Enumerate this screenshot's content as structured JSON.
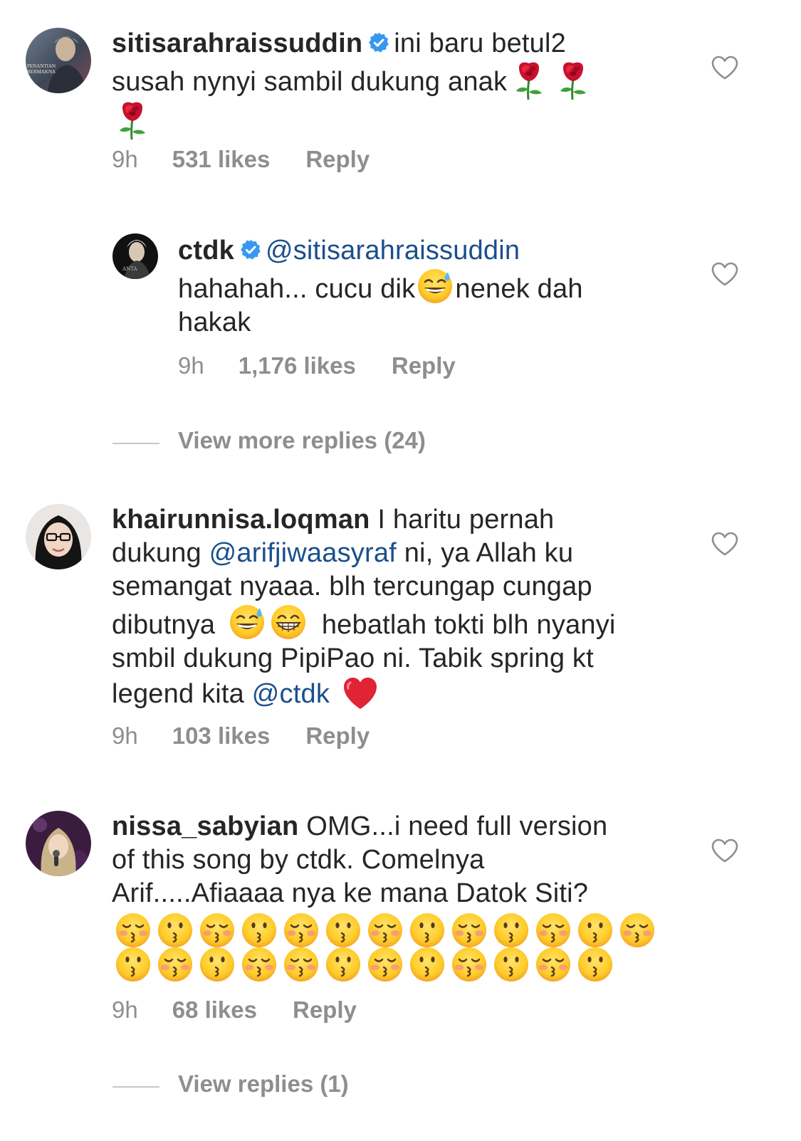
{
  "comments": [
    {
      "username": "sitisarahraissuddin",
      "verified": true,
      "text_1": "ini baru betul2",
      "text_2": "susah nynyi sambil dukung anak",
      "time": "9h",
      "likes": "531 likes",
      "reply": "Reply",
      "avatar_caption": "PENANTIAN BERMAKNA"
    },
    {
      "username": "ctdk",
      "verified": true,
      "mention": "@sitisarahraissuddin",
      "text_1": "hahahah... cucu dik",
      "text_2": "nenek dah",
      "text_3": "hakak",
      "time": "9h",
      "likes": "1,176 likes",
      "reply": "Reply"
    },
    {
      "username": "khairunnisa.loqman",
      "verified": false,
      "text_1": "I haritu pernah",
      "text_2": "dukung",
      "mention_1": "@arifjiwaasyraf",
      "text_3": "ni, ya Allah ku",
      "text_4": "semangat nyaaa. blh tercungap cungap",
      "text_5": "dibutnya",
      "text_6": "hebatlah tokti blh nyanyi",
      "text_7": "smbil dukung PipiPao ni. Tabik spring kt",
      "text_8": "legend kita",
      "mention_2": "@ctdk",
      "time": "9h",
      "likes": "103 likes",
      "reply": "Reply"
    },
    {
      "username": "nissa_sabyian",
      "verified": false,
      "text_1": "OMG...i need full version",
      "text_2": "of this song by ctdk. Comelnya",
      "text_3": "Arif.....Afiaaaa nya ke mana Datok Siti?",
      "time": "9h",
      "likes": "68 likes",
      "reply": "Reply"
    }
  ],
  "view_more_replies": "View more replies (24)",
  "view_replies": "View replies (1)",
  "colors": {
    "text": "#262626",
    "secondary": "#8e8e8e",
    "mention": "#1b4f8c",
    "verified": "#3897f0",
    "divider": "#c7c7c7"
  },
  "icons": [
    "verified-badge-icon",
    "heart-outline-icon",
    "rose-emoji",
    "sweat-smile-emoji",
    "grin-emoji",
    "red-heart-emoji",
    "kissing-closed-eyes-emoji",
    "kissing-emoji"
  ]
}
